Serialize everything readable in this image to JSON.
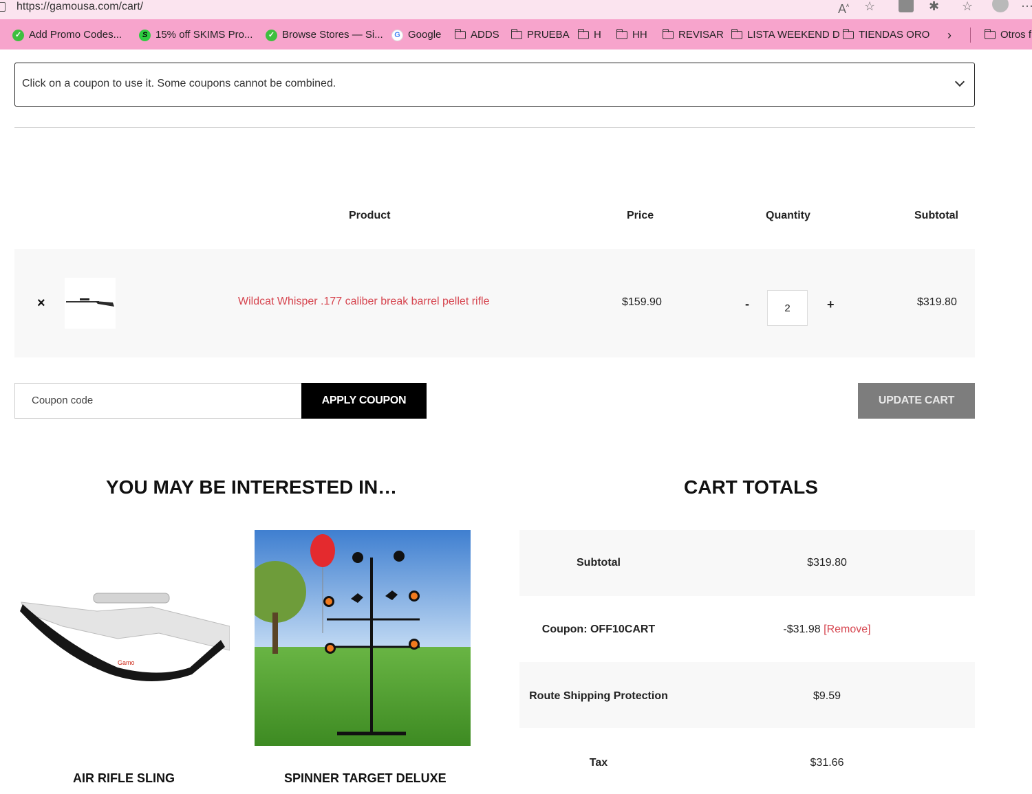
{
  "browser": {
    "url": "https://gamousa.com/cart/",
    "bookmarks": [
      {
        "label": "Add Promo Codes...",
        "icon": "promo-favicon"
      },
      {
        "label": "15% off SKIMS Pro...",
        "icon": "skims-favicon"
      },
      {
        "label": "Browse Stores — Si...",
        "icon": "promo-favicon"
      },
      {
        "label": "Google",
        "icon": "google-favicon"
      },
      {
        "label": "ADDS",
        "icon": "folder-icon"
      },
      {
        "label": "PRUEBA",
        "icon": "folder-icon"
      },
      {
        "label": "H",
        "icon": "folder-icon"
      },
      {
        "label": "HH",
        "icon": "folder-icon"
      },
      {
        "label": "REVISAR",
        "icon": "folder-icon"
      },
      {
        "label": "LISTA WEEKEND D",
        "icon": "folder-icon"
      },
      {
        "label": "TIENDAS ORO",
        "icon": "folder-icon"
      },
      {
        "label": "Otros f",
        "icon": "folder-icon"
      }
    ]
  },
  "coupons": {
    "dropdown_text": "Click on a coupon to use it. Some coupons cannot be combined."
  },
  "cart": {
    "headers": {
      "product": "Product",
      "price": "Price",
      "quantity": "Quantity",
      "subtotal": "Subtotal"
    },
    "items": [
      {
        "name": "Wildcat Whisper .177 caliber break barrel pellet rifle",
        "price": "$159.90",
        "quantity": "2",
        "subtotal": "$319.80"
      }
    ],
    "remove_symbol": "×",
    "qty_minus": "-",
    "qty_plus": "+",
    "coupon_placeholder": "Coupon code",
    "apply_label": "APPLY COUPON",
    "update_label": "UPDATE CART"
  },
  "related": {
    "heading": "YOU MAY BE INTERESTED IN…",
    "products": [
      {
        "title": "AIR RIFLE SLING"
      },
      {
        "title": "SPINNER TARGET DELUXE"
      }
    ]
  },
  "totals": {
    "heading": "CART TOTALS",
    "rows": [
      {
        "label": "Subtotal",
        "value": "$319.80"
      },
      {
        "label": "Coupon: OFF10CART",
        "value": "-$31.98",
        "link": "[Remove]"
      },
      {
        "label": "Route Shipping Protection",
        "value": "$9.59"
      },
      {
        "label": "Tax",
        "value": "$31.66"
      }
    ]
  },
  "colors": {
    "accent_link": "#d6454f",
    "bookmark_bar": "#f7a4cc",
    "update_button": "#7d7d7d"
  }
}
